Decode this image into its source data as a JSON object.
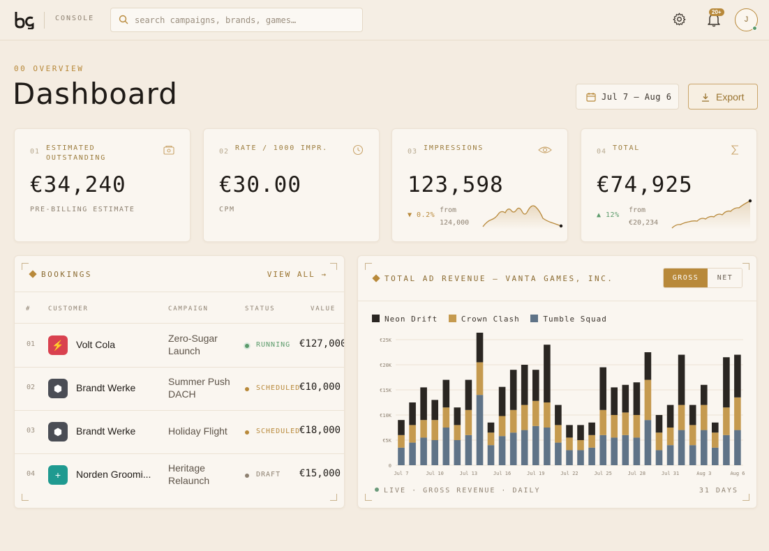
{
  "topbar": {
    "console_label": "CONSOLE",
    "search_placeholder": "search campaigns, brands, games…",
    "notifications_badge": "20+",
    "avatar_initial": "J"
  },
  "header": {
    "section_tag": "00 OVERVIEW",
    "title": "Dashboard",
    "date_range": "Jul 7 – Aug 6",
    "export_label": "Export"
  },
  "kpis": [
    {
      "num": "01",
      "label": "ESTIMATED OUTSTANDING",
      "icon": "wallet-icon",
      "value": "€34,240",
      "sub": "PRE-BILLING ESTIMATE"
    },
    {
      "num": "02",
      "label": "RATE / 1000 IMPR.",
      "icon": "gauge-icon",
      "value": "€30.00",
      "sub": "CPM"
    },
    {
      "num": "03",
      "label": "IMPRESSIONS",
      "icon": "eye-icon",
      "value": "123,598",
      "delta": "▼ 0.2%",
      "from_label": "from",
      "from_value": "124,000",
      "delta_color": "#b8893a"
    },
    {
      "num": "04",
      "label": "TOTAL",
      "icon": "sigma-icon",
      "value": "€74,925",
      "delta": "▲ 12%",
      "from_label": "from",
      "from_value": "€20,234",
      "delta_color": "#5a9a6a"
    }
  ],
  "bookings": {
    "title": "BOOKINGS",
    "view_all": "VIEW ALL →",
    "columns": [
      "#",
      "CUSTOMER",
      "CAMPAIGN",
      "STATUS",
      "VALUE"
    ],
    "rows": [
      {
        "idx": "01",
        "customer": "Volt Cola",
        "campaign": "Zero-Sugar Launch",
        "status": "RUNNING",
        "value": "€127,000",
        "logo_color": "#d9414f",
        "logo_glyph": "⚡",
        "status_color": "#5a9a6a"
      },
      {
        "idx": "02",
        "customer": "Brandt Werke",
        "campaign": "Summer Push DACH",
        "status": "SCHEDULED",
        "value": "€10,000",
        "logo_color": "#4a4d55",
        "logo_glyph": "⬢",
        "status_color": "#b8893a"
      },
      {
        "idx": "03",
        "customer": "Brandt Werke",
        "campaign": "Holiday Flight",
        "status": "SCHEDULED",
        "value": "€18,000",
        "logo_color": "#4a4d55",
        "logo_glyph": "⬢",
        "status_color": "#b8893a"
      },
      {
        "idx": "04",
        "customer": "Norden Groomi...",
        "campaign": "Heritage Relaunch",
        "status": "DRAFT",
        "value": "€15,000",
        "logo_color": "#1f9a90",
        "logo_glyph": "+",
        "status_color": "#8d8070"
      }
    ]
  },
  "revenue": {
    "title": "TOTAL AD REVENUE – VANTA GAMES, INC.",
    "toggle_gross": "GROSS",
    "toggle_net": "NET",
    "footer_left": "LIVE · GROSS REVENUE · DAILY",
    "footer_right": "31 DAYS"
  },
  "chart_data": {
    "type": "bar",
    "stacked": true,
    "categories": [
      "Jul 7",
      "Jul 8",
      "Jul 9",
      "Jul 10",
      "Jul 11",
      "Jul 12",
      "Jul 13",
      "Jul 14",
      "Jul 15",
      "Jul 16",
      "Jul 17",
      "Jul 18",
      "Jul 19",
      "Jul 20",
      "Jul 21",
      "Jul 22",
      "Jul 23",
      "Jul 24",
      "Jul 25",
      "Jul 26",
      "Jul 27",
      "Jul 28",
      "Jul 29",
      "Jul 30",
      "Jul 31",
      "Aug 1",
      "Aug 2",
      "Aug 3",
      "Aug 4",
      "Aug 5",
      "Aug 6"
    ],
    "tick_labels": [
      "Jul 7",
      "Jul 10",
      "Jul 13",
      "Jul 16",
      "Jul 19",
      "Jul 22",
      "Jul 25",
      "Jul 28",
      "Jul 31",
      "Aug 3",
      "Aug 6"
    ],
    "y_ticks": [
      "0",
      "€5K",
      "€10K",
      "€15K",
      "€20K",
      "€25K"
    ],
    "ylim": [
      0,
      25000
    ],
    "series": [
      {
        "name": "Tumble Squad",
        "color": "#5f7387",
        "values": [
          3500,
          4500,
          5500,
          5000,
          7500,
          5000,
          6000,
          14000,
          4000,
          5800,
          6500,
          7000,
          7800,
          7500,
          4500,
          3000,
          3000,
          3500,
          6000,
          5500,
          6000,
          5500,
          9000,
          3000,
          4000,
          7000,
          4000,
          7000,
          3500,
          6000,
          7000
        ]
      },
      {
        "name": "Crown Clash",
        "color": "#c59a4f",
        "values": [
          2500,
          3500,
          3500,
          4000,
          4000,
          3000,
          5000,
          6500,
          2500,
          4000,
          4500,
          5000,
          5000,
          5000,
          3500,
          2500,
          2000,
          2500,
          5000,
          4500,
          4500,
          4500,
          8000,
          3500,
          3500,
          5000,
          4000,
          5000,
          3000,
          5500,
          6500
        ]
      },
      {
        "name": "Neon Drift",
        "color": "#2a2622",
        "values": [
          3000,
          4500,
          6500,
          4000,
          5500,
          3500,
          6000,
          7500,
          2000,
          5800,
          8000,
          8000,
          6200,
          11500,
          4000,
          2500,
          3000,
          2500,
          8500,
          5500,
          5500,
          6500,
          5500,
          3500,
          4500,
          10000,
          4000,
          4000,
          2000,
          10000,
          8500
        ]
      }
    ]
  },
  "icons": {
    "logo": "logo-icon",
    "search": "search-icon",
    "settings": "gear-icon",
    "notifications": "bell-icon",
    "calendar": "calendar-icon",
    "download": "download-icon"
  },
  "colors": {
    "accent": "#b8893a",
    "background": "#f4ece1",
    "card": "#faf6f0"
  }
}
